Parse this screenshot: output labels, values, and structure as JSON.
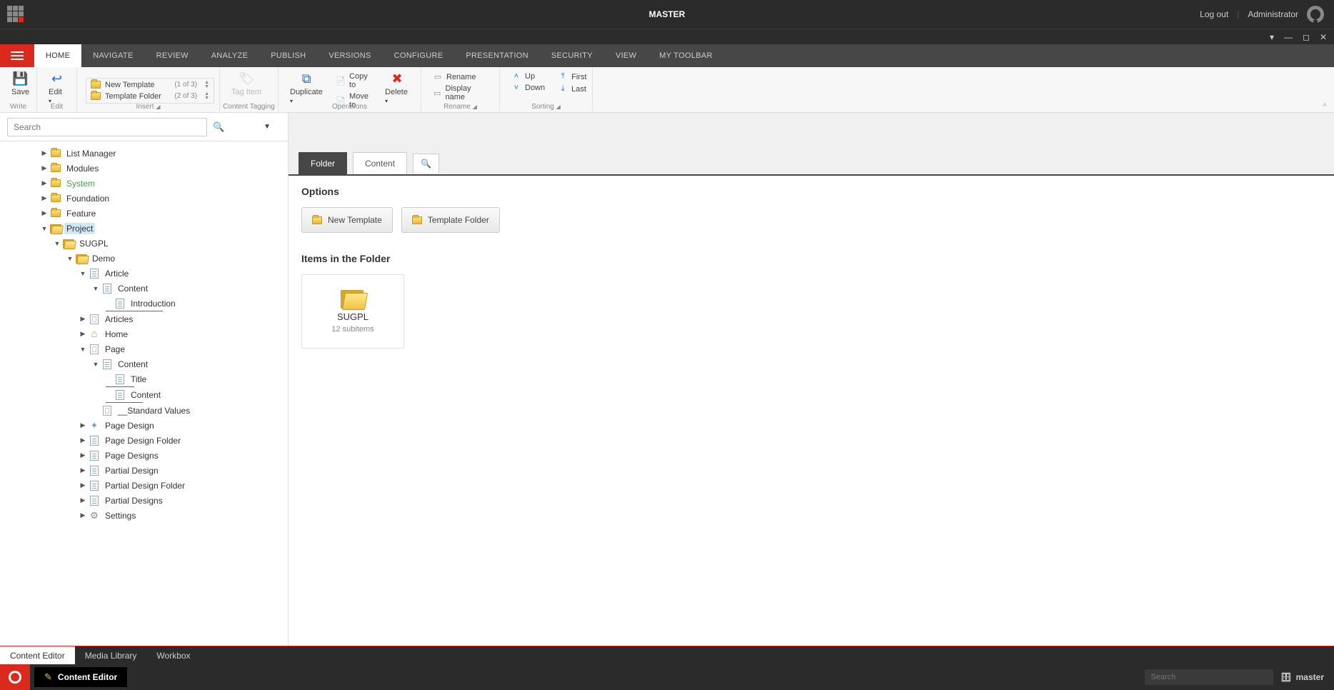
{
  "topbar": {
    "title": "MASTER",
    "logout": "Log out",
    "user": "Administrator"
  },
  "ribbon": {
    "tabs": [
      "HOME",
      "NAVIGATE",
      "REVIEW",
      "ANALYZE",
      "PUBLISH",
      "VERSIONS",
      "CONFIGURE",
      "PRESENTATION",
      "SECURITY",
      "VIEW",
      "MY TOOLBAR"
    ],
    "active_tab": "HOME",
    "groups": {
      "write": {
        "label": "Write",
        "save": "Save"
      },
      "edit": {
        "label": "Edit",
        "btn": "Edit"
      },
      "insert": {
        "label": "Insert",
        "item1": {
          "name": "New Template",
          "count": "(1 of 3)"
        },
        "item2": {
          "name": "Template Folder",
          "count": "(2 of 3)"
        }
      },
      "content_tagging": {
        "label": "Content Tagging",
        "btn": "Tag Item"
      },
      "operations": {
        "label": "Operations",
        "duplicate": "Duplicate",
        "copy_to": "Copy to",
        "move_to": "Move to",
        "delete": "Delete"
      },
      "rename": {
        "label": "Rename",
        "rename": "Rename",
        "display_name": "Display name"
      },
      "sorting": {
        "label": "Sorting",
        "up": "Up",
        "down": "Down",
        "first": "First",
        "last": "Last"
      }
    }
  },
  "search": {
    "placeholder": "Search"
  },
  "tree": {
    "n0": "List Manager",
    "n1": "Modules",
    "n2": "System",
    "n3": "Foundation",
    "n4": "Feature",
    "n5": "Project",
    "n6": "SUGPL",
    "n7": "Demo",
    "n8": "Article",
    "n9": "Content",
    "n10": "Introduction",
    "n11": "Articles",
    "n12": "Home",
    "n13": "Page",
    "n14": "Content",
    "n15": "Title",
    "n16": "Content",
    "n17": "__Standard Values",
    "n18": "Page Design",
    "n19": "Page Design Folder",
    "n20": "Page Designs",
    "n21": "Partial Design",
    "n22": "Partial Design Folder",
    "n23": "Partial Designs",
    "n24": "Settings"
  },
  "content": {
    "tab_folder": "Folder",
    "tab_content": "Content",
    "options_title": "Options",
    "opt_new_template": "New Template",
    "opt_template_folder": "Template Folder",
    "items_title": "Items in the Folder",
    "card": {
      "name": "SUGPL",
      "sub": "12 subitems"
    }
  },
  "bottom_tabs": {
    "t1": "Content Editor",
    "t2": "Media Library",
    "t3": "Workbox"
  },
  "footer": {
    "editor": "Content Editor",
    "search_placeholder": "Search",
    "db": "master"
  }
}
